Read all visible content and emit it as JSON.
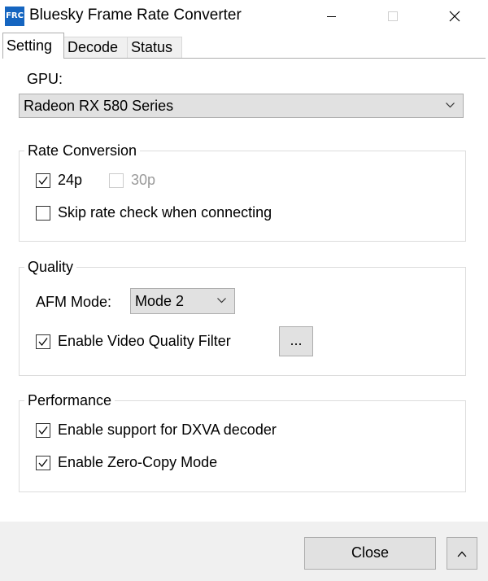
{
  "window": {
    "icon_text": "FRC",
    "title": "Bluesky Frame Rate Converter"
  },
  "tabs": [
    {
      "label": "Setting",
      "active": true
    },
    {
      "label": "Decode",
      "active": false
    },
    {
      "label": "Status",
      "active": false
    }
  ],
  "gpu": {
    "label": "GPU:",
    "selected": "Radeon RX 580 Series"
  },
  "rate_conversion": {
    "title": "Rate Conversion",
    "opt_24p": {
      "label": "24p",
      "checked": true
    },
    "opt_30p": {
      "label": "30p",
      "checked": false,
      "enabled": false
    },
    "skip_rate_check": {
      "label": "Skip rate check when connecting",
      "checked": false
    }
  },
  "quality": {
    "title": "Quality",
    "afm_label": "AFM Mode:",
    "afm_selected": "Mode 2",
    "video_filter": {
      "label": "Enable Video Quality Filter",
      "checked": true
    },
    "filter_settings_button": "..."
  },
  "performance": {
    "title": "Performance",
    "dxva": {
      "label": "Enable support for DXVA decoder",
      "checked": true
    },
    "zero_copy": {
      "label": "Enable Zero-Copy Mode",
      "checked": true
    }
  },
  "footer": {
    "close_button": "Close"
  },
  "colors": {
    "accent": "#1565c0",
    "control_face": "#e1e1e1",
    "control_border": "#adadad",
    "disabled_text": "#9a9a9a"
  }
}
